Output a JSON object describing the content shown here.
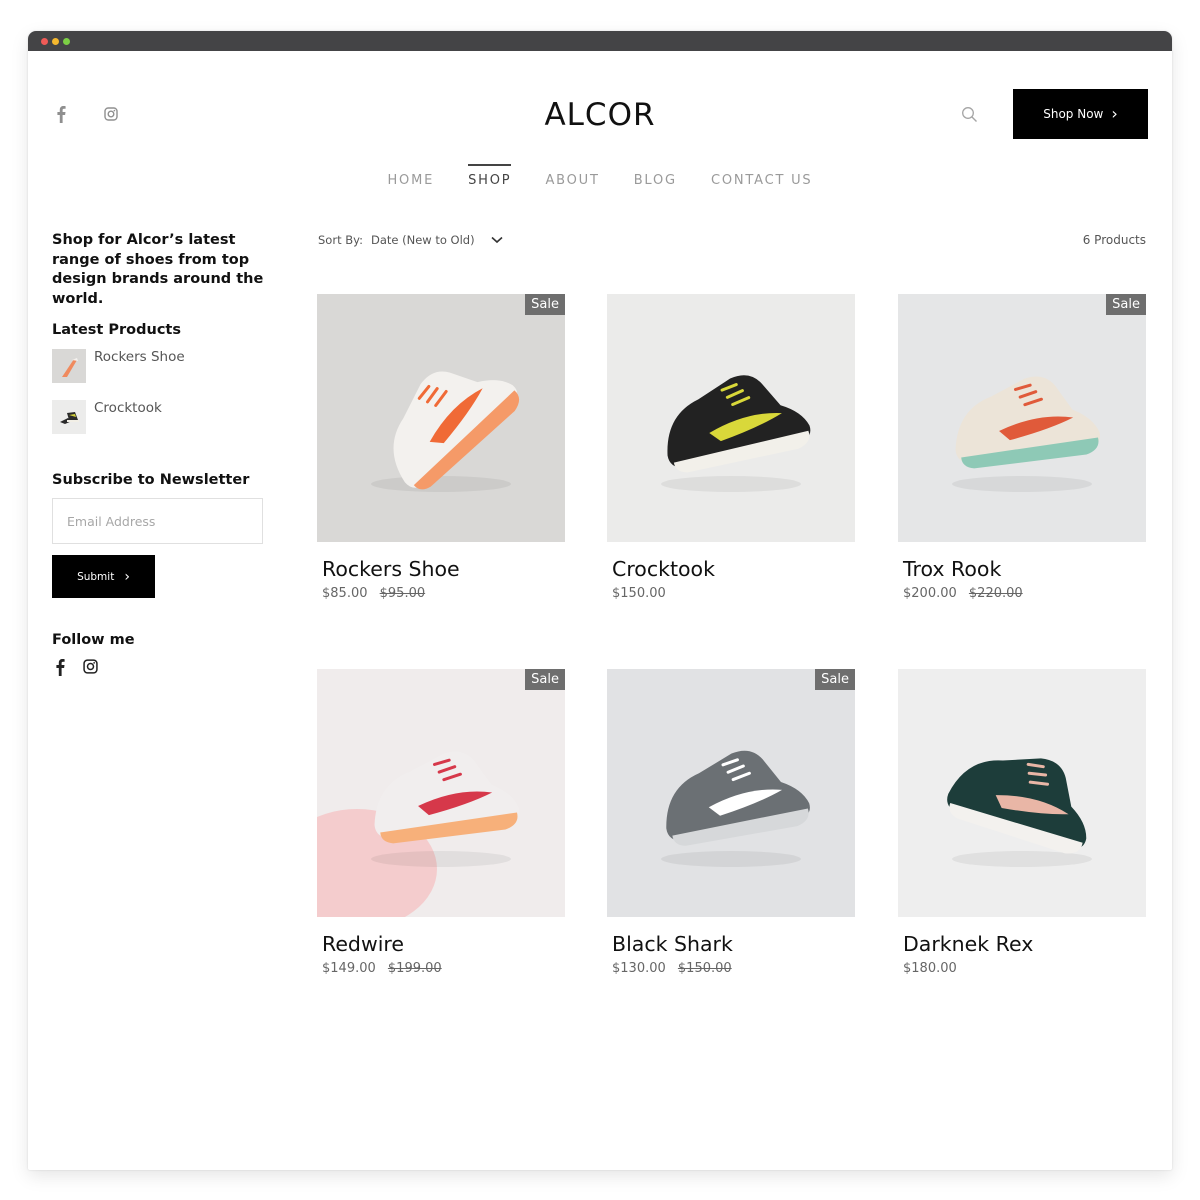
{
  "window": {
    "controls": [
      "close",
      "minimize",
      "maximize"
    ]
  },
  "header": {
    "social": [
      {
        "icon": "facebook-icon",
        "glyph": "f"
      },
      {
        "icon": "instagram-icon",
        "glyph": ""
      }
    ],
    "logo": "ALCOR",
    "search_icon": "search-icon",
    "cta": {
      "label": "Shop Now",
      "icon": "chevron-right-icon",
      "glyph": "›"
    }
  },
  "nav": {
    "items": [
      {
        "label": "HOME",
        "active": false
      },
      {
        "label": "SHOP",
        "active": true
      },
      {
        "label": "ABOUT",
        "active": false
      },
      {
        "label": "BLOG",
        "active": false
      },
      {
        "label": "CONTACT US",
        "active": false
      }
    ]
  },
  "sidebar": {
    "intro": "Shop for Alcor’s latest range of shoes from top design brands around the world.",
    "latest": {
      "title": "Latest Products",
      "items": [
        {
          "name": "Rockers Shoe"
        },
        {
          "name": "Crocktook"
        }
      ]
    },
    "newsletter": {
      "title": "Subscribe to Newsletter",
      "email_placeholder": "Email Address",
      "email_value": "",
      "submit_label": "Submit",
      "submit_glyph": "›"
    },
    "follow": {
      "title": "Follow me",
      "icons": [
        "facebook-icon",
        "instagram-icon"
      ]
    }
  },
  "shop": {
    "sort_label": "Sort By:",
    "sort_value": "Date (New to Old)",
    "product_count": "6 Products",
    "sale_badge": "Sale",
    "products": [
      {
        "name": "Rockers Shoe",
        "price": "$85.00",
        "old_price": "$95.00",
        "sale": true,
        "colors": {
          "bg": "#d9d8d6",
          "main": "#f3f1ee",
          "accent": "#f06a36",
          "sole": "#f59a68"
        }
      },
      {
        "name": "Crocktook",
        "price": "$150.00",
        "old_price": "",
        "sale": false,
        "colors": {
          "bg": "#ebebea",
          "main": "#222222",
          "accent": "#d9d83a",
          "sole": "#f2f0ea"
        }
      },
      {
        "name": "Trox Rook",
        "price": "$200.00",
        "old_price": "$220.00",
        "sale": true,
        "colors": {
          "bg": "#e5e6e7",
          "main": "#ece4d8",
          "accent": "#e05a3a",
          "sole": "#8ec9b6"
        }
      },
      {
        "name": "Redwire",
        "price": "$149.00",
        "old_price": "$199.00",
        "sale": true,
        "colors": {
          "bg": "#f0ecec",
          "main": "#f1eeee",
          "accent": "#d6384a",
          "sole": "#f7b07a"
        }
      },
      {
        "name": "Black Shark",
        "price": "$130.00",
        "old_price": "$150.00",
        "sale": true,
        "colors": {
          "bg": "#e1e2e4",
          "main": "#6b7074",
          "accent": "#ffffff",
          "sole": "#d6d8da"
        }
      },
      {
        "name": "Darknek Rex",
        "price": "$180.00",
        "old_price": "",
        "sale": false,
        "colors": {
          "bg": "#eeeeee",
          "main": "#1d3d3a",
          "accent": "#e9b6a6",
          "sole": "#f3f1ee"
        }
      }
    ]
  }
}
